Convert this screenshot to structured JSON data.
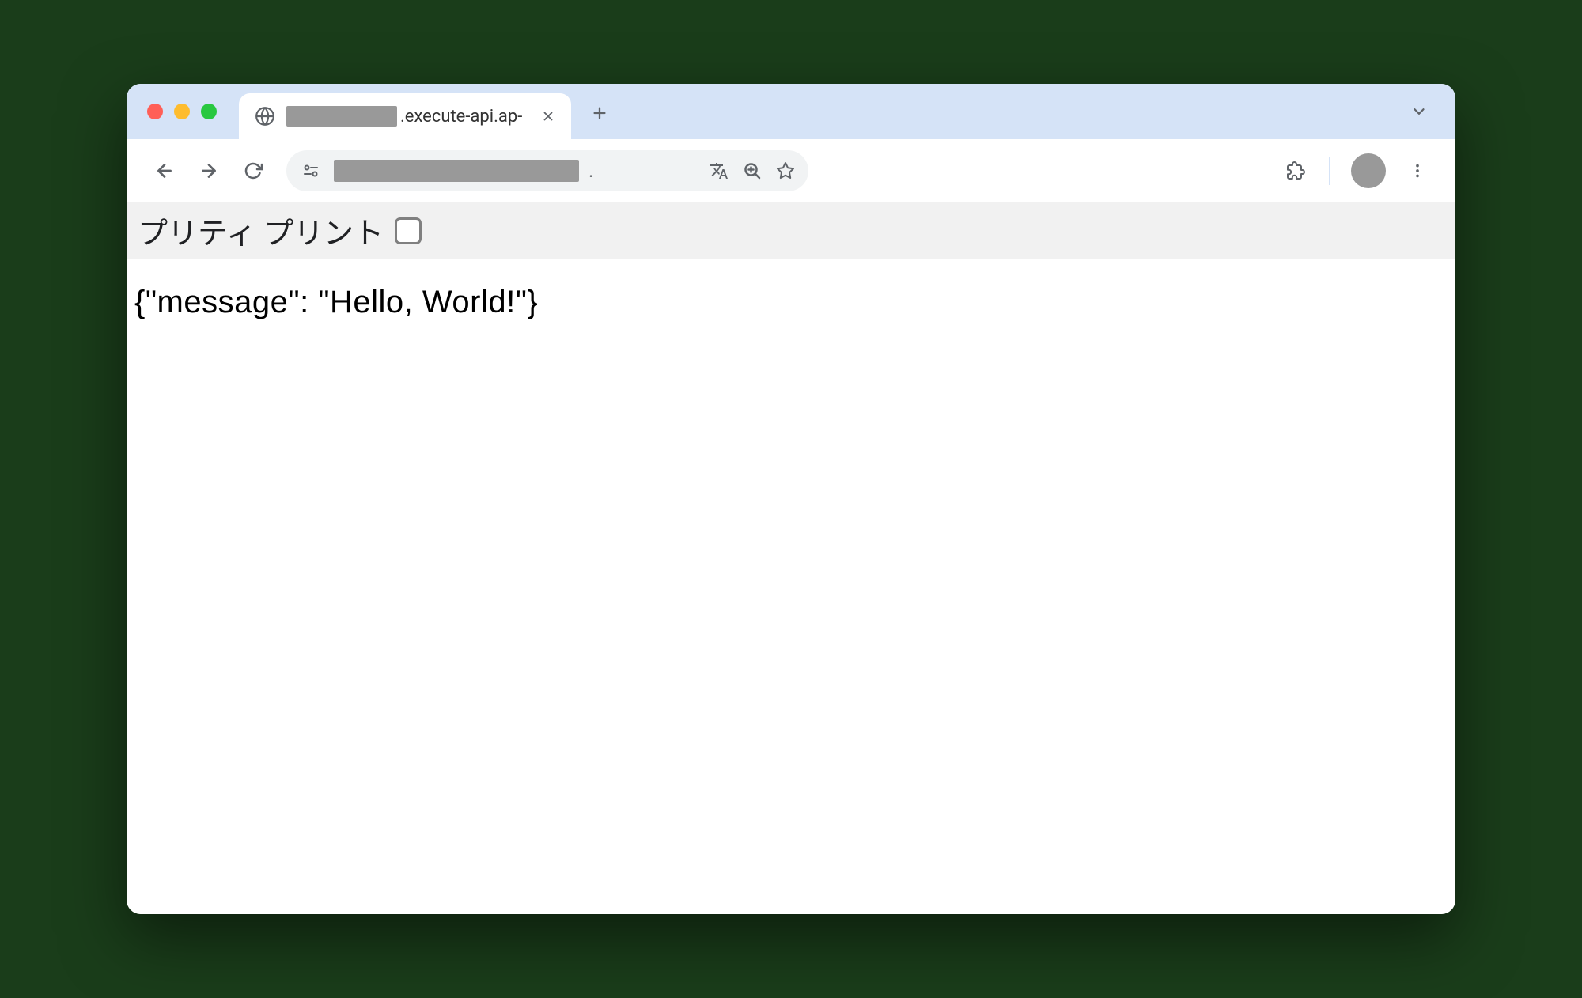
{
  "window": {
    "tab": {
      "title_visible": ".execute-api.ap-"
    }
  },
  "json_viewer": {
    "pretty_print_label": "プリティ プリント",
    "pretty_print_checked": false
  },
  "page_content": {
    "raw_json": "{\"message\": \"Hello, World!\"}"
  }
}
